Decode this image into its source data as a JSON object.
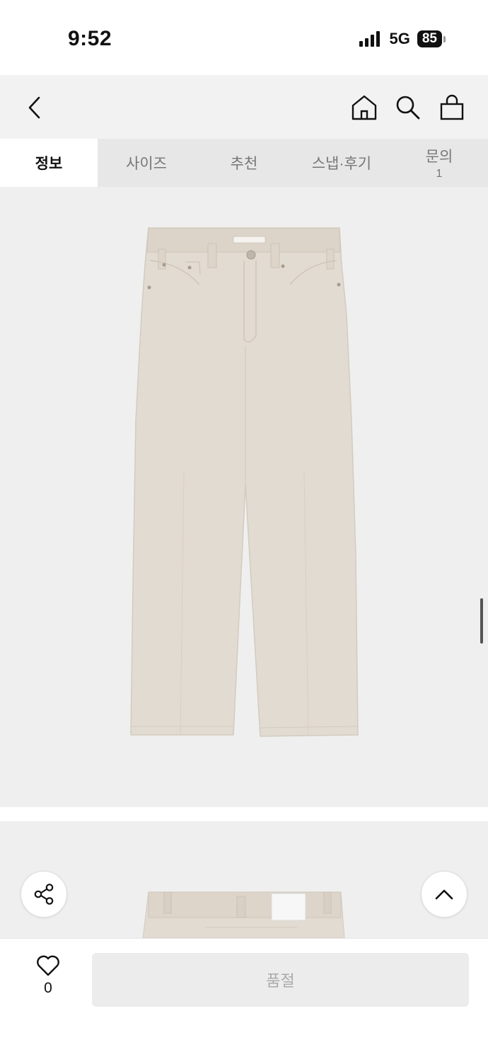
{
  "status_bar": {
    "time": "9:52",
    "network": "5G",
    "battery": "85"
  },
  "nav": {
    "icons": [
      "chevron-left-icon",
      "home-icon",
      "search-icon",
      "shopping-bag-icon"
    ]
  },
  "tabs": [
    {
      "label": "정보",
      "active": true,
      "count": ""
    },
    {
      "label": "사이즈",
      "active": false,
      "count": ""
    },
    {
      "label": "추천",
      "active": false,
      "count": ""
    },
    {
      "label": "스냅·후기",
      "active": false,
      "count": ""
    },
    {
      "label": "문의",
      "active": false,
      "count": "1"
    }
  ],
  "product_images": {
    "garment_color": "#e2dbd1",
    "background_color": "#efefef"
  },
  "floating": {
    "share_icon": "share-icon",
    "top_icon": "chevron-up-icon"
  },
  "bottom_bar": {
    "like_count": "0",
    "soldout_label": "품절"
  }
}
